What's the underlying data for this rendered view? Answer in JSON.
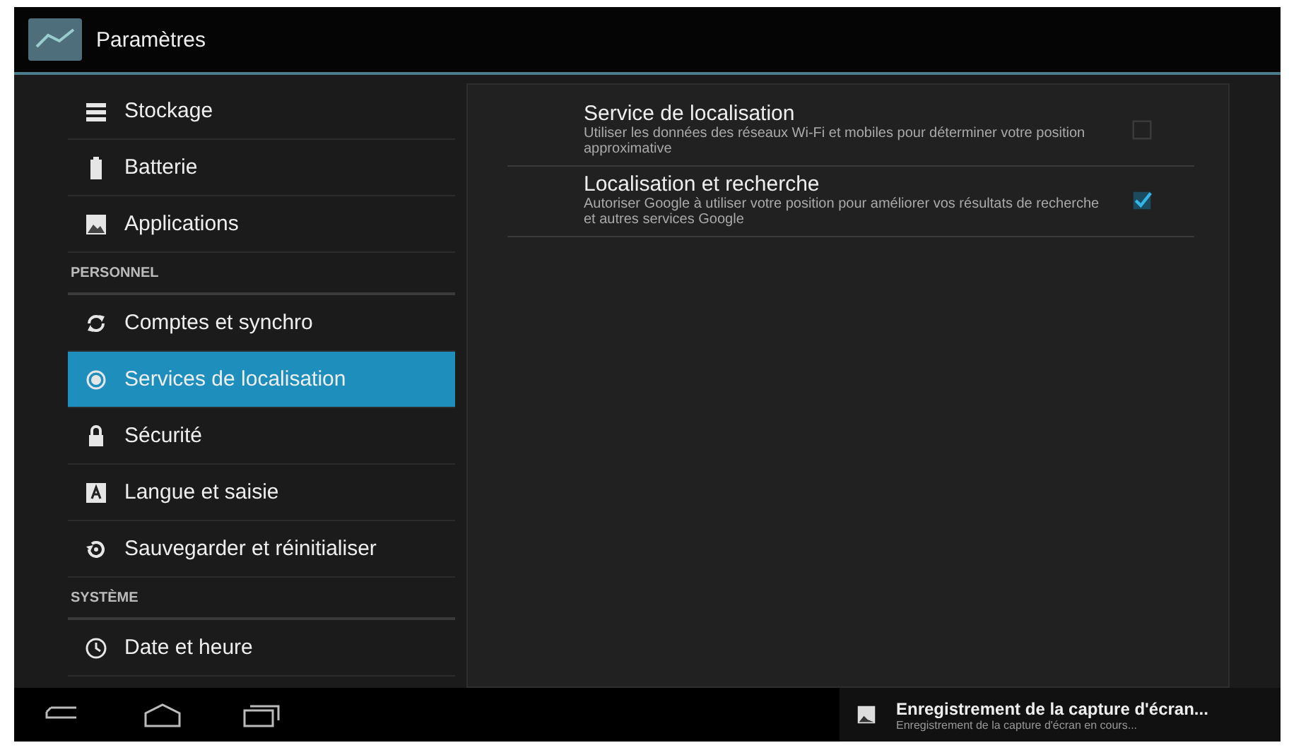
{
  "action_bar": {
    "title": "Paramètres"
  },
  "sidebar": {
    "items": [
      {
        "kind": "item",
        "label": "Stockage",
        "selected": false
      },
      {
        "kind": "item",
        "label": "Batterie",
        "selected": false
      },
      {
        "kind": "item",
        "label": "Applications",
        "selected": false
      },
      {
        "kind": "header",
        "label": "PERSONNEL"
      },
      {
        "kind": "item",
        "label": "Comptes et synchro",
        "selected": false
      },
      {
        "kind": "item",
        "label": "Services de localisation",
        "selected": true
      },
      {
        "kind": "item",
        "label": "Sécurité",
        "selected": false
      },
      {
        "kind": "item",
        "label": "Langue et saisie",
        "selected": false
      },
      {
        "kind": "item",
        "label": "Sauvegarder et réinitialiser",
        "selected": false
      },
      {
        "kind": "header",
        "label": "SYSTÈME"
      },
      {
        "kind": "item",
        "label": "Date et heure",
        "selected": false
      }
    ]
  },
  "settings": [
    {
      "title": "Service de localisation",
      "summary": "Utiliser les données des réseaux Wi-Fi et mobiles pour déterminer votre position approximative",
      "checked": false
    },
    {
      "title": "Localisation et recherche",
      "summary": "Autoriser Google à utiliser votre position pour améliorer vos résultats de recherche et autres services Google",
      "checked": true
    }
  ],
  "notification": {
    "title": "Enregistrement de la capture d'écran...",
    "text": "Enregistrement de la capture d'écran en cours..."
  }
}
